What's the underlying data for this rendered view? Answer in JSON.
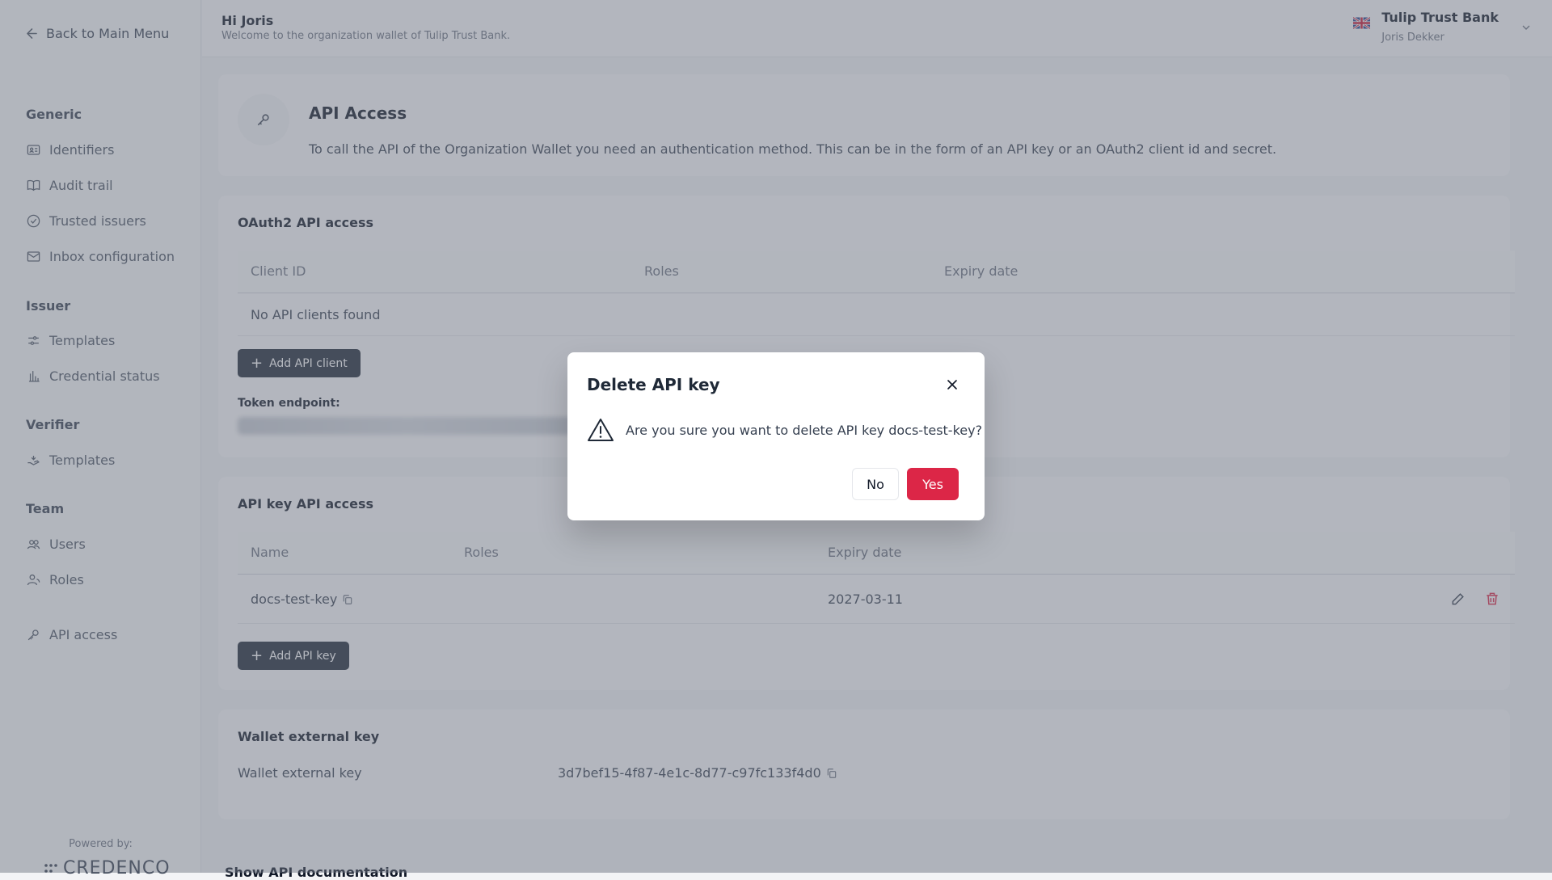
{
  "sidebar": {
    "back_label": "Back to Main Menu",
    "groups": [
      {
        "title": "Generic",
        "items": [
          "Identifiers",
          "Audit trail",
          "Trusted issuers",
          "Inbox configuration"
        ]
      },
      {
        "title": "Issuer",
        "items": [
          "Templates",
          "Credential status"
        ]
      },
      {
        "title": "Verifier",
        "items": [
          "Templates"
        ]
      },
      {
        "title": "Team",
        "items": [
          "Users",
          "Roles"
        ]
      }
    ],
    "api_access": "API access",
    "powered_by": "Powered by:",
    "brand": "CREDENCO"
  },
  "header": {
    "greeting": "Hi Joris",
    "welcome": "Welcome to the organization wallet of Tulip Trust Bank.",
    "org_name": "Tulip Trust Bank",
    "user_name": "Joris Dekker"
  },
  "intro": {
    "title": "API Access",
    "description": "To call the API of the Organization Wallet you need an authentication method. This can be in the form of an API key or an OAuth2 client id and secret."
  },
  "oauth": {
    "title": "OAuth2 API access",
    "columns": [
      "Client ID",
      "Roles",
      "Expiry date"
    ],
    "empty": "No API clients found",
    "add_button": "Add API client",
    "token_label": "Token endpoint:"
  },
  "apikey": {
    "title": "API key API access",
    "columns": [
      "Name",
      "Roles",
      "Expiry date"
    ],
    "rows": [
      {
        "name": "docs-test-key",
        "roles": "",
        "expiry": "2027-03-11"
      }
    ],
    "add_button": "Add API key"
  },
  "wallet": {
    "title": "Wallet external key",
    "label": "Wallet external key",
    "value": "3d7bef15-4f87-4e1c-8d77-c97fc133f4d0"
  },
  "show_docs": "Show API documentation",
  "modal": {
    "title": "Delete API key",
    "message": "Are you sure you want to delete API key docs-test-key?",
    "no_label": "No",
    "yes_label": "Yes"
  },
  "colors": {
    "danger": "#dc2647",
    "dark_button": "#1f2937"
  }
}
